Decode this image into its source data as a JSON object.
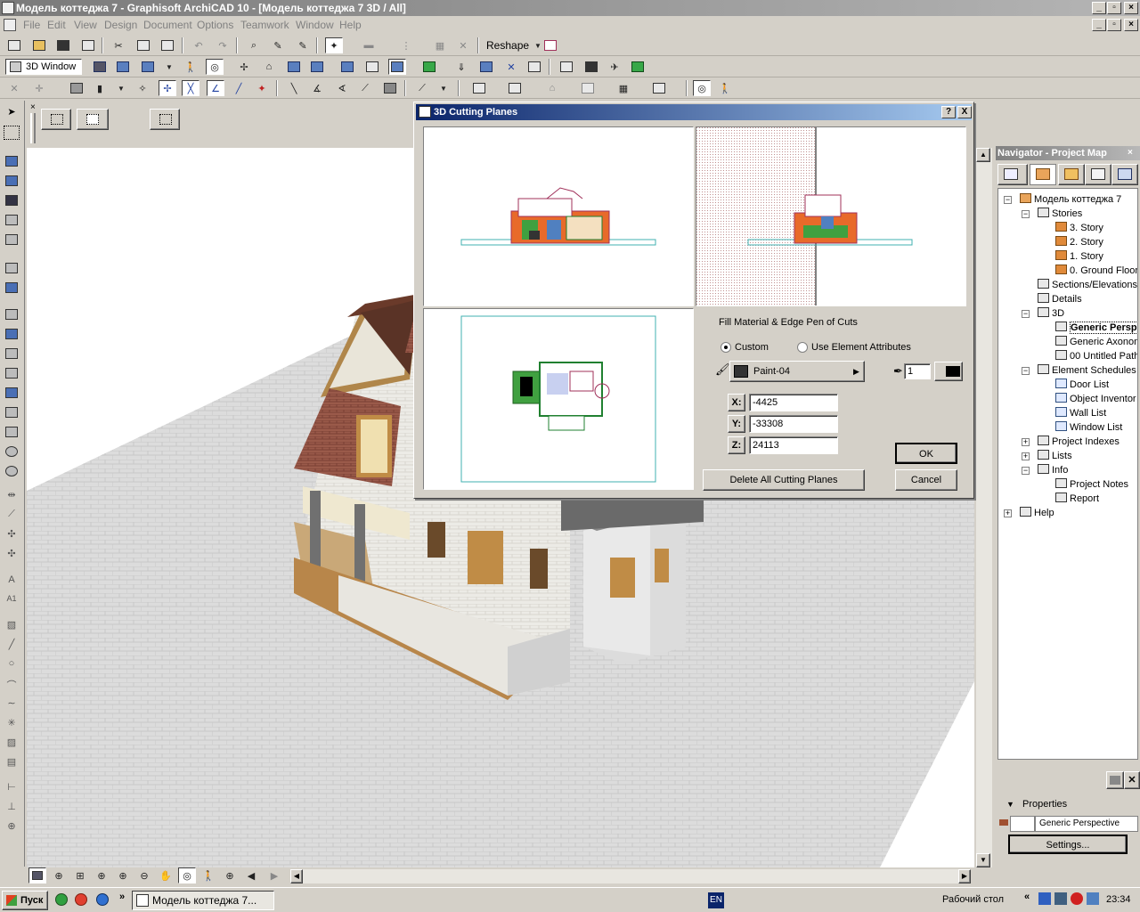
{
  "window": {
    "title": "Модель коттеджа 7 - Graphisoft ArchiCAD 10 - [Модель коттеджа 7 3D / All]"
  },
  "menu": [
    "File",
    "Edit",
    "View",
    "Design",
    "Document",
    "Options",
    "Teamwork",
    "Window",
    "Help"
  ],
  "toolbar": {
    "reshape_label": "Reshape",
    "window_label": "3D Window"
  },
  "navigator": {
    "title": "Navigator - Project Map",
    "tree": [
      {
        "label": "Модель коттеджа 7",
        "icon": "project-icon",
        "level": 0,
        "expander": "-"
      },
      {
        "label": "Stories",
        "icon": "stories-icon",
        "level": 1,
        "expander": "-"
      },
      {
        "label": "3. Story",
        "icon": "story-icon",
        "level": 2
      },
      {
        "label": "2. Story",
        "icon": "story-icon",
        "level": 2
      },
      {
        "label": "1. Story",
        "icon": "story-icon",
        "level": 2
      },
      {
        "label": "0. Ground Floor",
        "icon": "story-icon",
        "level": 2
      },
      {
        "label": "Sections/Elevations",
        "icon": "section-icon",
        "level": 1
      },
      {
        "label": "Details",
        "icon": "details-icon",
        "level": 1
      },
      {
        "label": "3D",
        "icon": "3d-icon",
        "level": 1,
        "expander": "-"
      },
      {
        "label": "Generic Persp",
        "icon": "camera-icon",
        "level": 2,
        "selected": true
      },
      {
        "label": "Generic Axonom",
        "icon": "axonometry-icon",
        "level": 2
      },
      {
        "label": "00 Untitled Path",
        "icon": "path-icon",
        "level": 2
      },
      {
        "label": "Element Schedules",
        "icon": "schedule-icon",
        "level": 1,
        "expander": "-"
      },
      {
        "label": "Door List",
        "icon": "list-icon",
        "level": 2
      },
      {
        "label": "Object Inventor",
        "icon": "list-icon",
        "level": 2
      },
      {
        "label": "Wall List",
        "icon": "list-icon",
        "level": 2
      },
      {
        "label": "Window List",
        "icon": "list-icon",
        "level": 2
      },
      {
        "label": "Project Indexes",
        "icon": "index-icon",
        "level": 1,
        "expander": "+"
      },
      {
        "label": "Lists",
        "icon": "lists-icon",
        "level": 1,
        "expander": "+"
      },
      {
        "label": "Info",
        "icon": "info-icon",
        "level": 1,
        "expander": "-"
      },
      {
        "label": "Project Notes",
        "icon": "notes-icon",
        "level": 2
      },
      {
        "label": "Report",
        "icon": "report-icon",
        "level": 2
      },
      {
        "label": "Help",
        "icon": "help-icon",
        "level": 0,
        "expander": "+"
      }
    ],
    "properties_label": "Properties",
    "properties_value": "Generic Perspective",
    "settings_label": "Settings..."
  },
  "dialog": {
    "title": "3D Cutting Planes",
    "section_label": "Fill Material & Edge Pen of Cuts",
    "radio_custom": "Custom",
    "radio_element": "Use Element Attributes",
    "material": "Paint-04",
    "pen_number": "1",
    "x_label": "X:",
    "x_value": "-4425",
    "y_label": "Y:",
    "y_value": "-33308",
    "z_label": "Z:",
    "z_value": "24113",
    "ok_label": "OK",
    "cancel_label": "Cancel",
    "delete_label": "Delete All Cutting Planes",
    "help_label": "?",
    "close_label": "X"
  },
  "taskbar": {
    "start_label": "Пуск",
    "task_label": "Модель коттеджа 7...",
    "lang": "EN",
    "desktop_label": "Рабочий стол",
    "clock": "23:34"
  },
  "colors": {
    "dialog_title_start": "#0a246a",
    "dialog_title_end": "#a6caf0",
    "chrome": "#d4d0c8"
  }
}
